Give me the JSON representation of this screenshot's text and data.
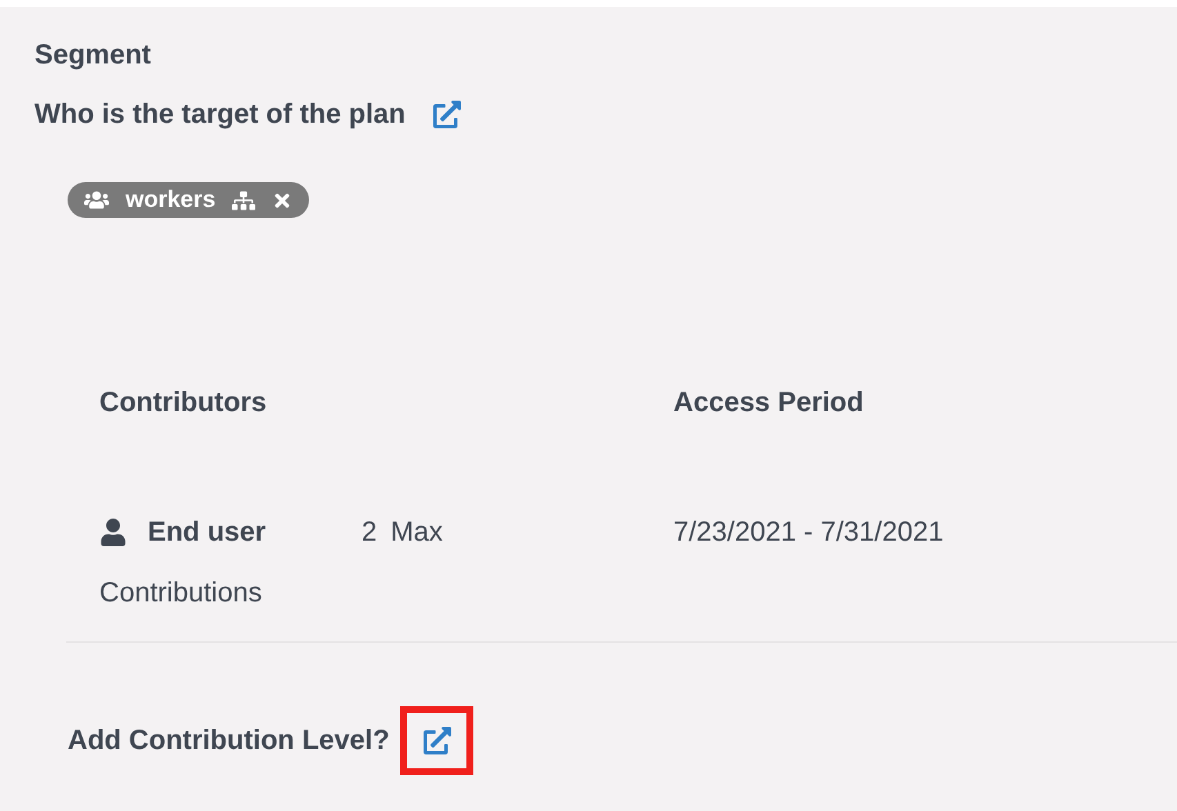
{
  "section_title": "Segment",
  "target": {
    "label": "Who is the target of the plan",
    "tags": [
      {
        "label": "workers"
      }
    ]
  },
  "table": {
    "columns": [
      "Contributors",
      "Access Period"
    ],
    "rows": [
      {
        "role": "End user",
        "count": "2",
        "limit": "Max",
        "note": "Contributions",
        "period": "7/23/2021 - 7/31/2021"
      }
    ]
  },
  "add_level": {
    "label": "Add Contribution Level?",
    "highlighted": true
  }
}
